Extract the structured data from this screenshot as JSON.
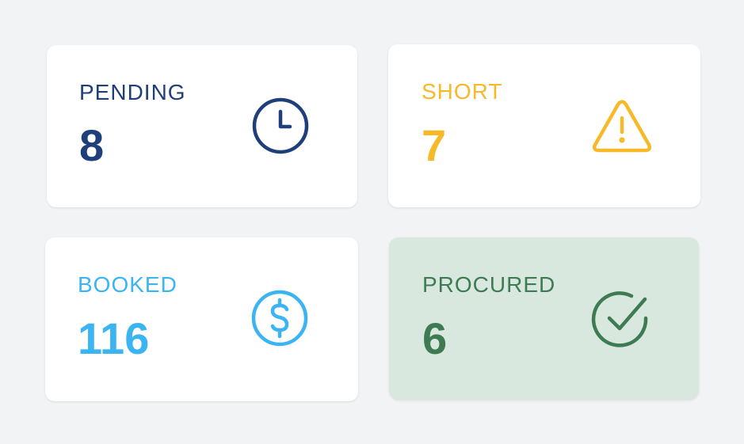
{
  "cards": [
    {
      "label": "PENDING",
      "value": "8",
      "icon": "clock-icon",
      "color": "#1f3f7a",
      "background": "#ffffff"
    },
    {
      "label": "SHORT",
      "value": "7",
      "icon": "warning-triangle-icon",
      "color": "#f7b928",
      "background": "#ffffff"
    },
    {
      "label": "BOOKED",
      "value": "116",
      "icon": "dollar-circle-icon",
      "color": "#3bb4f2",
      "background": "#ffffff"
    },
    {
      "label": "PROCURED",
      "value": "6",
      "icon": "check-circle-icon",
      "color": "#3e7a52",
      "background": "#d9e8df"
    }
  ],
  "page_background": "#f2f3f5"
}
